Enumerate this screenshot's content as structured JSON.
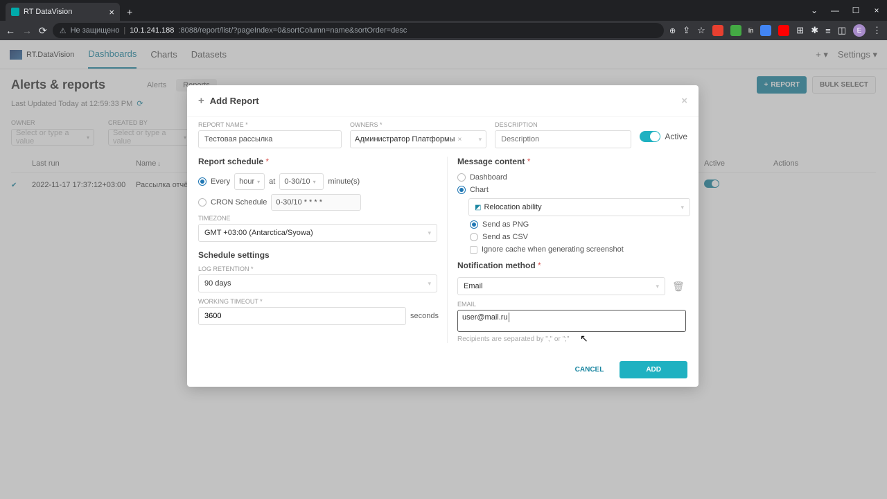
{
  "browser": {
    "tab_title": "RT DataVision",
    "security_label": "Не защищено",
    "url_host": "10.1.241.188",
    "url_rest": ":8088/report/list/?pageIndex=0&sortColumn=name&sortOrder=desc",
    "avatar_initial": "E"
  },
  "header": {
    "logo": "RT.DataVision",
    "nav": [
      "Dashboards",
      "Charts",
      "Datasets"
    ],
    "plus": "+",
    "settings": "Settings"
  },
  "page": {
    "title": "Alerts & reports",
    "tabs": {
      "alerts": "Alerts",
      "reports": "Reports"
    },
    "btn_report": "REPORT",
    "btn_bulk": "BULK SELECT",
    "last_updated": "Last Updated Today at 12:59:33 PM",
    "filters": {
      "owner_label": "OWNER",
      "owner_placeholder": "Select or type a value",
      "createdby_label": "CREATED BY",
      "createdby_placeholder": "Select or type a value"
    },
    "columns": {
      "lastrun": "Last run",
      "name": "Name",
      "active": "Active",
      "actions": "Actions"
    },
    "rows": [
      {
        "lastrun": "2022-11-17 17:37:12+03:00",
        "name": "Рассылка отчёт",
        "active": true
      }
    ]
  },
  "modal": {
    "title": "Add Report",
    "report_name_label": "REPORT NAME *",
    "report_name_value": "Тестовая рассылка",
    "owners_label": "OWNERS *",
    "owners_value": "Администратор Платформы",
    "description_label": "DESCRIPTION",
    "description_placeholder": "Description",
    "active_label": "Active",
    "schedule_title": "Report schedule",
    "every_label": "Every",
    "every_unit": "hour",
    "at_label": "at",
    "minutes_value": "0-30/10",
    "minutes_suffix": "minute(s)",
    "cron_label": "CRON Schedule",
    "cron_value": "0-30/10 * * * *",
    "timezone_label": "TIMEZONE",
    "timezone_value": "GMT +03:00 (Antarctica/Syowa)",
    "settings_title": "Schedule settings",
    "log_retention_label": "LOG RETENTION *",
    "log_retention_value": "90 days",
    "working_timeout_label": "WORKING TIMEOUT *",
    "working_timeout_value": "3600",
    "seconds": "seconds",
    "message_title": "Message content",
    "opt_dashboard": "Dashboard",
    "opt_chart": "Chart",
    "chart_value": "Relocation ability",
    "opt_png": "Send as PNG",
    "opt_csv": "Send as CSV",
    "opt_ignore": "Ignore cache when generating screenshot",
    "notif_title": "Notification method",
    "notif_value": "Email",
    "email_label": "EMAIL",
    "email_value": "user@mail.ru",
    "email_hint": "Recipients are separated by \",\" or \";\"",
    "cancel": "CANCEL",
    "add": "ADD"
  }
}
